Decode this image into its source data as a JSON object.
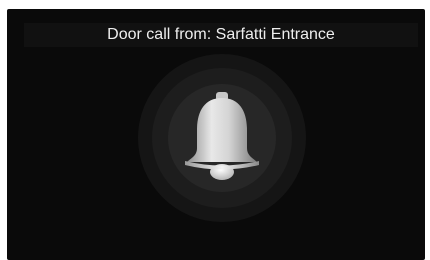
{
  "call": {
    "title": "Door call from: Sarfatti Entrance"
  },
  "icon": {
    "name": "bell-icon"
  },
  "colors": {
    "background": "#0a0a0a",
    "title_bar": "#111111",
    "text": "#eeeeee",
    "bell": "#cfcfcf"
  }
}
